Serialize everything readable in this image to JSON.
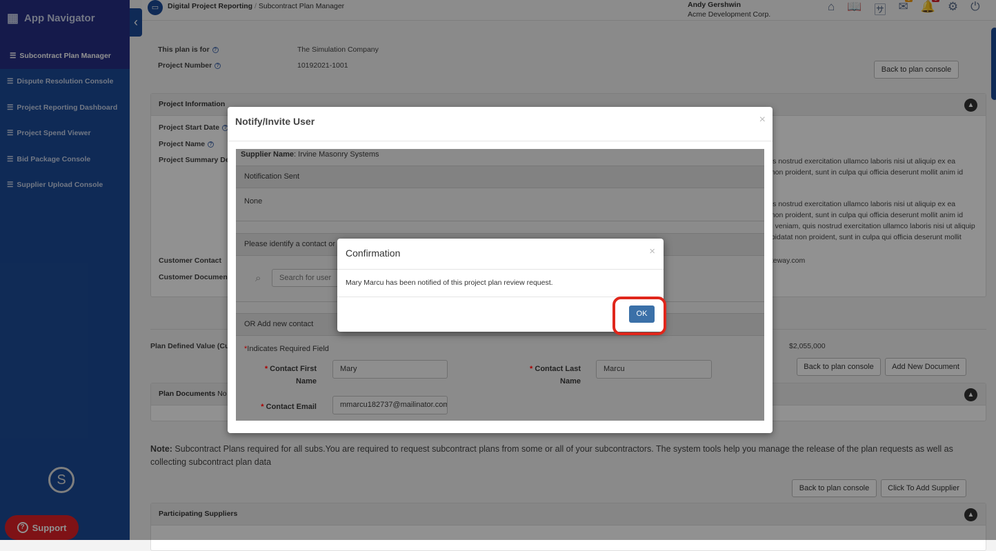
{
  "sidebar": {
    "title": "App Navigator",
    "items": [
      {
        "label": "Subcontract Plan Manager",
        "active": true
      },
      {
        "label": "Dispute Resolution Console"
      },
      {
        "label": "Project Reporting Dashboard"
      },
      {
        "label": "Project Spend Viewer"
      },
      {
        "label": "Bid Package Console"
      },
      {
        "label": "Supplier Upload Console"
      }
    ],
    "support": "Support"
  },
  "header": {
    "breadcrumb": [
      "Digital Project Reporting",
      "Subcontract Plan Manager"
    ],
    "user": "Andy Gershwin",
    "company": "Acme Development Corp.",
    "badges": {
      "mail": "0",
      "bell": "0"
    }
  },
  "plan": {
    "for_label": "This plan is for",
    "for_value": "The Simulation Company",
    "number_label": "Project Number",
    "number_value": "10192021-1001",
    "back": "Back to plan console"
  },
  "project_info": {
    "title": "Project Information",
    "start_date": "Project Start Date",
    "name": "Project Name",
    "summary": "Project Summary De",
    "contact": "Customer Contact",
    "document": "Customer Document",
    "contact_value": "ateway.com",
    "lorem": [
      "uis nostrud exercitation ullamco laboris nisi ut aliquip ex ea",
      "t non proident, sunt in culpa qui officia deserunt mollit anim id",
      "uis nostrud exercitation ullamco laboris nisi ut aliquip ex ea",
      "t non proident, sunt in culpa qui officia deserunt mollit anim id",
      "m veniam, quis nostrud exercitation ullamco laboris nisi ut aliquip",
      "upidatat non proident, sunt in culpa qui officia deserunt mollit"
    ]
  },
  "value": {
    "label": "Plan Defined Value (Cu",
    "amount": "$2,055,000",
    "back": "Back to plan console",
    "add_doc": "Add New Document"
  },
  "plan_docs": {
    "title": "Plan Documents",
    "extra": "No"
  },
  "note": {
    "bold": "Note:",
    "text": " Subcontract Plans required for all subs.You are required to request subcontract plans from some or all of your subcontractors. The system tools help you manage the release of the plan requests as well as collecting subcontract plan data"
  },
  "suppliers": {
    "back": "Back to plan console",
    "add": "Click To Add Supplier",
    "title": "Participating Suppliers"
  },
  "notify": {
    "title": "Notify/Invite User",
    "supplier_label": "Supplier Name",
    "supplier_value": ": Irvine Masonry Systems",
    "sent_header": "Notification Sent",
    "sent_value": "None",
    "identify": "Please identify a contact or",
    "search_placeholder": "Search for user",
    "add_header": "OR Add new contact",
    "required": "Indicates Required Field",
    "first_label": "Contact First Name",
    "first_value": "Mary",
    "last_label": "Contact Last Name",
    "last_value": "Marcu",
    "email_label": "Contact Email",
    "email_value": "mmarcu182737@mailinator.com"
  },
  "confirm": {
    "title": "Confirmation",
    "message": "Mary Marcu has been notified of this project plan review request.",
    "ok": "OK",
    "close": "×"
  },
  "colors": {
    "highlight": "#e0261b",
    "ok": "#3b70a8",
    "support": "#c8151b"
  }
}
